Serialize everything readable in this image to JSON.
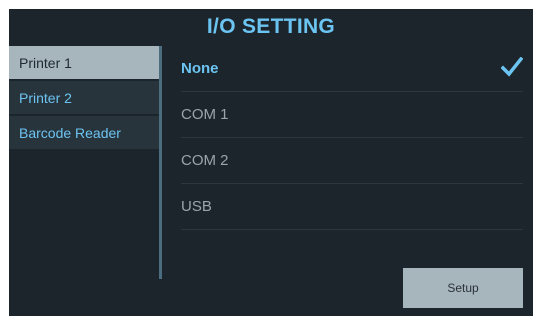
{
  "header": {
    "title": "I/O SETTING"
  },
  "sidebar": {
    "items": [
      {
        "label": "Printer 1",
        "active": true
      },
      {
        "label": "Printer 2",
        "active": false
      },
      {
        "label": "Barcode Reader",
        "active": false
      }
    ]
  },
  "options": {
    "items": [
      {
        "label": "None",
        "selected": true
      },
      {
        "label": "COM 1",
        "selected": false
      },
      {
        "label": "COM 2",
        "selected": false
      },
      {
        "label": "USB",
        "selected": false
      }
    ],
    "selected_icon": "check-icon"
  },
  "actions": {
    "setup_label": "Setup"
  },
  "colors": {
    "accent": "#6cc4f2",
    "background": "#1c252b",
    "sidebar_item": "#28343b",
    "active_item": "#a7b5bc",
    "button": "#a7b5bc"
  }
}
